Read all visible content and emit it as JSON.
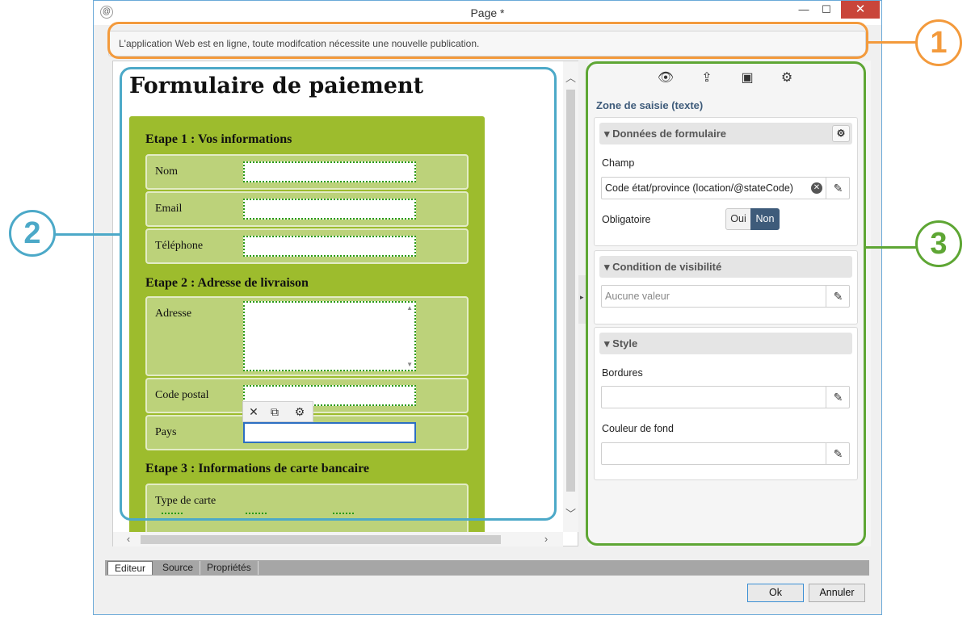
{
  "window": {
    "title": "Page *",
    "icon_char": "@",
    "minimize_glyph": "—",
    "maximize_glyph": "☐",
    "close_glyph": "✕"
  },
  "notice": "L'application Web est en ligne, toute modifcation nécessite une nouvelle publication.",
  "form": {
    "title": "Formulaire de paiement",
    "step1": {
      "title": "Etape 1 : Vos informations",
      "fields": [
        "Nom",
        "Email",
        "Téléphone"
      ]
    },
    "step2": {
      "title": "Etape 2 : Adresse de livraison",
      "fields": [
        "Adresse",
        "Code postal",
        "Pays"
      ]
    },
    "step3": {
      "title": "Etape 3 : Informations de carte bancaire",
      "fields": [
        "Type de carte"
      ]
    }
  },
  "mini_toolbar": {
    "delete_glyph": "✕",
    "copy_glyph": "⧉",
    "settings_glyph": "⚙"
  },
  "props": {
    "toolbar_glyphs": {
      "preview": "👁",
      "upload": "⇪",
      "save": "▣",
      "settings": "⚙"
    },
    "title": "Zone de saisie (texte)",
    "form_data": {
      "header": "Données de formulaire",
      "champ_label": "Champ",
      "champ_value": "Code état/province (location/@stateCode)",
      "obligatoire_label": "Obligatoire",
      "oui": "Oui",
      "non": "Non"
    },
    "visibility": {
      "header": "Condition de visibilité",
      "placeholder": "Aucune valeur"
    },
    "style": {
      "header": "Style",
      "borders_label": "Bordures",
      "bg_label": "Couleur de fond"
    },
    "edit_glyph": "✎",
    "clear_glyph": "✕",
    "gear_glyph": "⚙",
    "collapse_glyph": "▾"
  },
  "tabs": [
    "Editeur",
    "Source",
    "Propriétés"
  ],
  "buttons": {
    "ok": "Ok",
    "cancel": "Annuler"
  },
  "annotations": {
    "one": "1",
    "two": "2",
    "three": "3",
    "colors": {
      "orange": "#f39a3c",
      "blue": "#4ca9c8",
      "green": "#5ea634"
    }
  }
}
